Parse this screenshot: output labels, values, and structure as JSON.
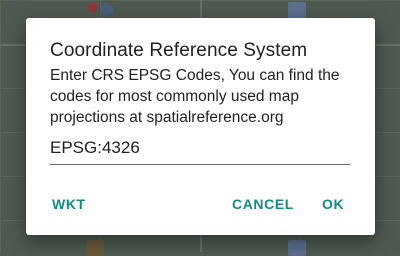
{
  "dialog": {
    "title": "Coordinate Reference System",
    "message": "Enter CRS EPSG Codes, You can find the codes for most commonly used map projections at spatialreference.org",
    "input_value": "EPSG:4326",
    "buttons": {
      "wkt": "WKT",
      "cancel": "CANCEL",
      "ok": "OK"
    }
  },
  "colors": {
    "accent": "#138b84",
    "scrim": "#4e5a51",
    "dialog_bg": "#ffffff"
  },
  "icons": {
    "map_pin": "map-pin-icon",
    "layers": "layers-icon",
    "document": "document-icon",
    "folder": "folder-icon"
  }
}
